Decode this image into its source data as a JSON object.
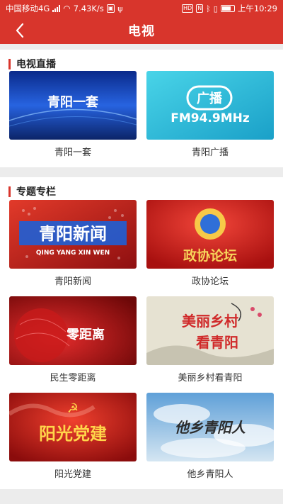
{
  "status_bar": {
    "carrier": "中国移动4G",
    "network_tag": "4G",
    "speed": "7.43K/s",
    "time": "上午10:29",
    "badges": [
      "HD",
      "N"
    ],
    "icons": [
      "wifi-icon",
      "signal-icon",
      "bluetooth-icon",
      "vibrate-icon",
      "battery-icon"
    ]
  },
  "header": {
    "title": "电视",
    "back_icon": "chevron-left-icon"
  },
  "sections": {
    "live": {
      "title": "电视直播",
      "items": [
        {
          "label": "青阳一套",
          "thumb_text": "青阳一套"
        },
        {
          "label": "青阳广播",
          "thumb_text_1": "广播",
          "thumb_text_2": "FM94.9MHz"
        }
      ]
    },
    "topics": {
      "title": "专题专栏",
      "items": [
        {
          "label": "青阳新闻",
          "thumb_text": "青阳新闻",
          "thumb_sub": "QING YANG XIN WEN"
        },
        {
          "label": "政协论坛",
          "thumb_text": "政协论坛"
        },
        {
          "label": "民生零距离",
          "thumb_text": "零距离"
        },
        {
          "label": "美丽乡村看青阳",
          "thumb_text_1": "美丽乡村",
          "thumb_text_2": "看青阳"
        },
        {
          "label": "阳光党建",
          "thumb_text": "阳光党建"
        },
        {
          "label": "他乡青阳人",
          "thumb_text": "他乡青阳人"
        }
      ]
    }
  },
  "colors": {
    "brand_red": "#d8352c",
    "background": "#ececec",
    "card_background": "#ffffff"
  }
}
